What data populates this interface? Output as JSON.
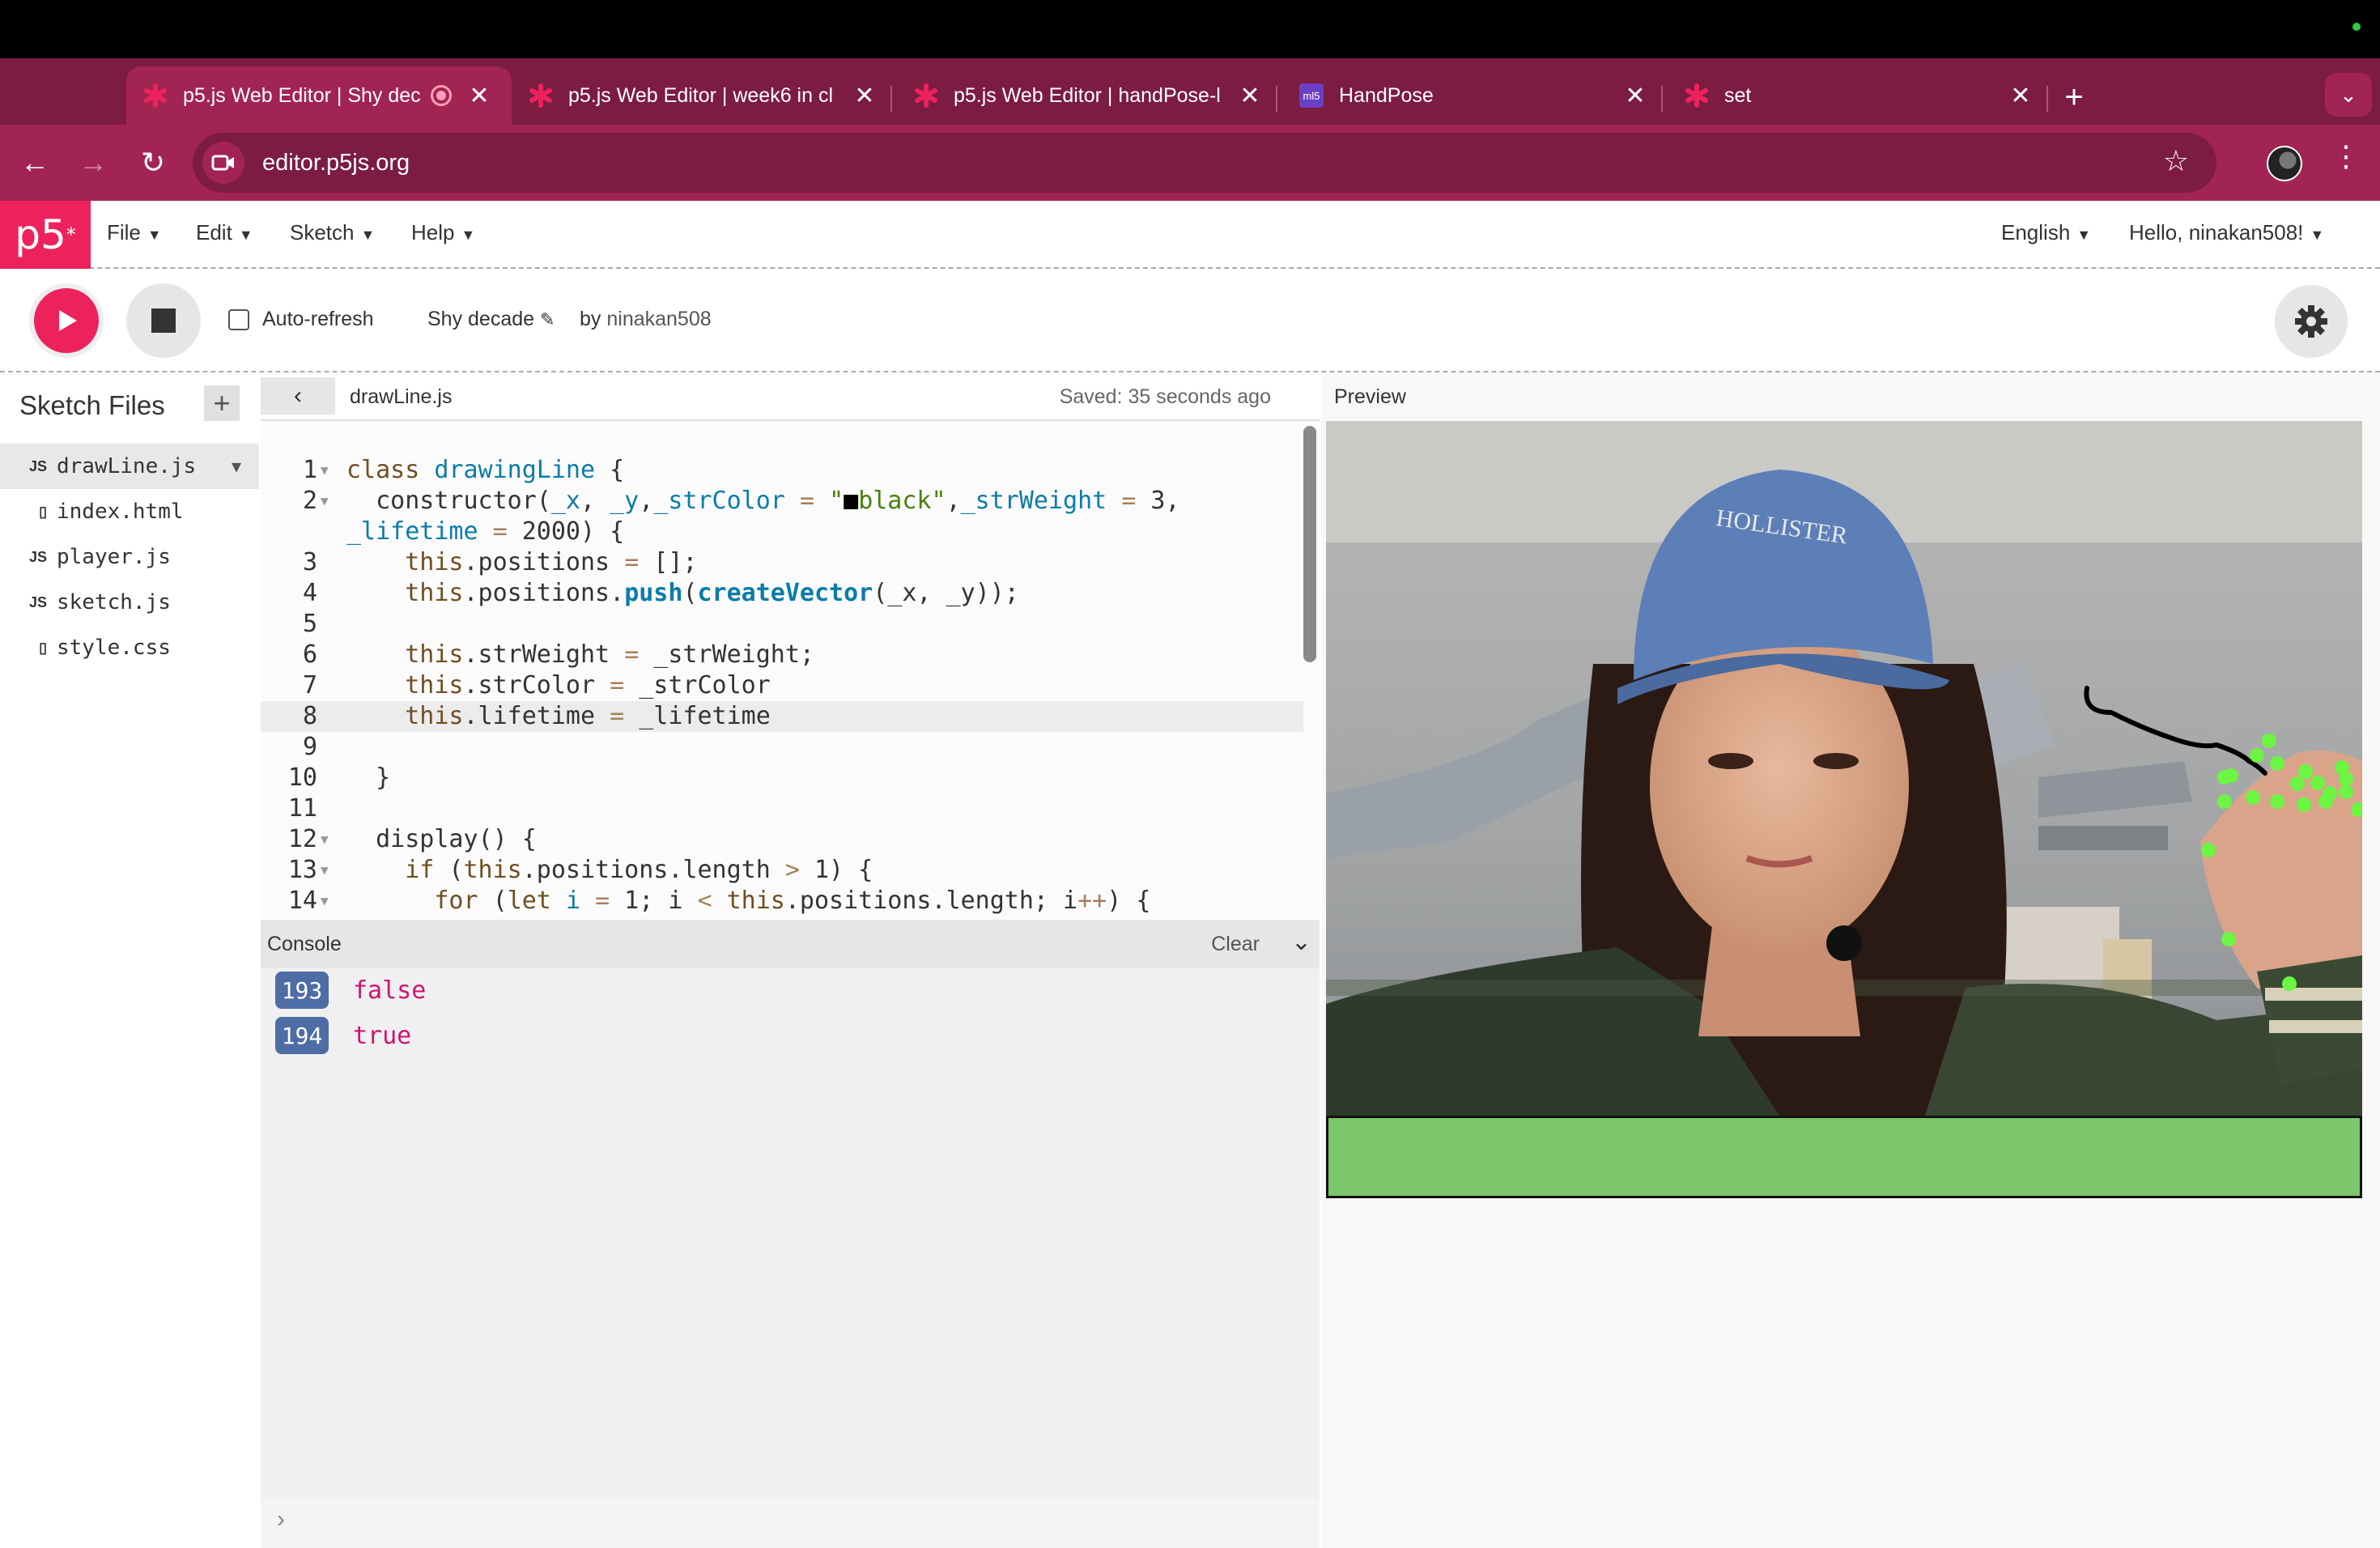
{
  "browser": {
    "tabs": [
      {
        "title": "p5.js Web Editor | Shy dec",
        "active": true,
        "recording": true
      },
      {
        "title": "p5.js Web Editor | week6 in cl",
        "active": false
      },
      {
        "title": "p5.js Web Editor | handPose-l",
        "active": false
      },
      {
        "title": "HandPose",
        "active": false,
        "favicon_text": "ml5"
      },
      {
        "title": "set",
        "active": false
      }
    ],
    "url": "editor.p5js.org",
    "colors": {
      "tabstrip": "#7c1c41",
      "toolbar": "#a12452"
    }
  },
  "nav": {
    "logo": "p5",
    "menus": [
      "File",
      "Edit",
      "Sketch",
      "Help"
    ],
    "language": "English",
    "user_greeting": "Hello, ninakan508!"
  },
  "sketch": {
    "auto_refresh_label": "Auto-refresh",
    "auto_refresh_checked": false,
    "name": "Shy decade",
    "by_label": "by",
    "owner": "ninakan508"
  },
  "sidebar": {
    "title": "Sketch Files",
    "files": [
      {
        "icon": "JS",
        "name": "drawLine.js",
        "selected": true
      },
      {
        "icon": "html-file-icon",
        "name": "index.html"
      },
      {
        "icon": "JS",
        "name": "player.js"
      },
      {
        "icon": "JS",
        "name": "sketch.js"
      },
      {
        "icon": "css-file-icon",
        "name": "style.css"
      }
    ]
  },
  "editor": {
    "filename": "drawLine.js",
    "saved_status": "Saved: 35 seconds ago",
    "highlighted_line": 8,
    "lines": [
      {
        "n": "1",
        "fold": true
      },
      {
        "n": "2",
        "fold": true
      },
      {
        "n": "",
        "fold": false
      },
      {
        "n": "3",
        "fold": false
      },
      {
        "n": "4",
        "fold": false
      },
      {
        "n": "5",
        "fold": false
      },
      {
        "n": "6",
        "fold": false
      },
      {
        "n": "7",
        "fold": false
      },
      {
        "n": "8",
        "fold": false
      },
      {
        "n": "9",
        "fold": false
      },
      {
        "n": "10",
        "fold": false
      },
      {
        "n": "11",
        "fold": false
      },
      {
        "n": "12",
        "fold": true
      },
      {
        "n": "13",
        "fold": true
      },
      {
        "n": "14",
        "fold": true
      }
    ],
    "code": [
      "class drawingLine {",
      "  constructor(_x, _y,_strColor = \"■black\",_strWeight = 3,",
      "_lifetime = 2000) {",
      "    this.positions = [];",
      "    this.positions.push(createVector(_x, _y));",
      "",
      "    this.strWeight = _strWeight;",
      "    this.strColor = _strColor",
      "    this.lifetime = _lifetime",
      "",
      "  }",
      "",
      "  display() {",
      "    if (this.positions.length > 1) {",
      "      for (let i = 1; i < this.positions.length; i++) {"
    ]
  },
  "console": {
    "title": "Console",
    "clear_label": "Clear",
    "messages": [
      {
        "count": "193",
        "text": "false"
      },
      {
        "count": "194",
        "text": "true"
      }
    ]
  },
  "preview": {
    "label": "Preview",
    "cap_text": "HOLLISTER",
    "hand_points_color": "#6cf542",
    "canvas_bar_color": "#7cc66c"
  }
}
